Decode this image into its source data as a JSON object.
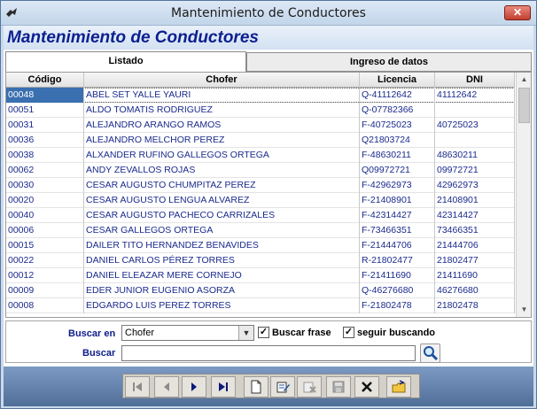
{
  "window": {
    "title": "Mantenimiento de  Conductores",
    "close_label": "✕"
  },
  "form": {
    "header_title": "Mantenimiento de Conductores"
  },
  "tabs": [
    {
      "label": "Listado",
      "active": true
    },
    {
      "label": "Ingreso de datos",
      "active": false
    }
  ],
  "grid": {
    "columns": [
      "Código",
      "Chofer",
      "Licencia",
      "DNI"
    ],
    "rows": [
      {
        "codigo": "00048",
        "chofer": "ABEL SET YALLE YAURI",
        "licencia": "Q-41112642",
        "dni": "41112642"
      },
      {
        "codigo": "00051",
        "chofer": "ALDO TOMATIS RODRIGUEZ",
        "licencia": "Q-07782366",
        "dni": ""
      },
      {
        "codigo": "00031",
        "chofer": "ALEJANDRO ARANGO RAMOS",
        "licencia": "F-40725023",
        "dni": "40725023"
      },
      {
        "codigo": "00036",
        "chofer": "ALEJANDRO MELCHOR PEREZ",
        "licencia": "Q21803724",
        "dni": ""
      },
      {
        "codigo": "00038",
        "chofer": "ALXANDER RUFINO GALLEGOS ORTEGA",
        "licencia": "F-48630211",
        "dni": "48630211"
      },
      {
        "codigo": "00062",
        "chofer": "ANDY ZEVALLOS ROJAS",
        "licencia": "Q09972721",
        "dni": "09972721"
      },
      {
        "codigo": "00030",
        "chofer": "CESAR AUGUSTO CHUMPITAZ PEREZ",
        "licencia": "F-42962973",
        "dni": "42962973"
      },
      {
        "codigo": "00020",
        "chofer": "CESAR AUGUSTO LENGUA ALVAREZ",
        "licencia": "F-21408901",
        "dni": "21408901"
      },
      {
        "codigo": "00040",
        "chofer": "CESAR AUGUSTO PACHECO CARRIZALES",
        "licencia": "F-42314427",
        "dni": "42314427"
      },
      {
        "codigo": "00006",
        "chofer": "CESAR GALLEGOS ORTEGA",
        "licencia": "F-73466351",
        "dni": "73466351"
      },
      {
        "codigo": "00015",
        "chofer": "DAILER TITO HERNANDEZ BENAVIDES",
        "licencia": "F-21444706",
        "dni": "21444706"
      },
      {
        "codigo": "00022",
        "chofer": "DANIEL CARLOS PÉREZ TORRES",
        "licencia": "R-21802477",
        "dni": "21802477"
      },
      {
        "codigo": "00012",
        "chofer": "DANIEL ELEAZAR MERE CORNEJO",
        "licencia": "F-21411690",
        "dni": "21411690"
      },
      {
        "codigo": "00009",
        "chofer": "EDER JUNIOR EUGENIO ASORZA",
        "licencia": "Q-46276680",
        "dni": "46276680"
      },
      {
        "codigo": "00008",
        "chofer": "EDGARDO LUIS PEREZ TORRES",
        "licencia": "F-21802478",
        "dni": "21802478"
      }
    ]
  },
  "search": {
    "buscar_en_label": "Buscar en",
    "buscar_en_value": "Chofer",
    "buscar_frase_label": "Buscar frase",
    "buscar_frase_checked": "✓",
    "seguir_buscando_label": "seguir buscando",
    "seguir_buscando_checked": "✓",
    "buscar_label": "Buscar",
    "buscar_value": ""
  },
  "toolbar": {
    "buttons": [
      "first-icon",
      "prev-icon",
      "next-icon",
      "last-icon",
      "new-icon",
      "edit-icon",
      "delete-icon",
      "save-icon",
      "cancel-icon",
      "exit-icon"
    ]
  }
}
